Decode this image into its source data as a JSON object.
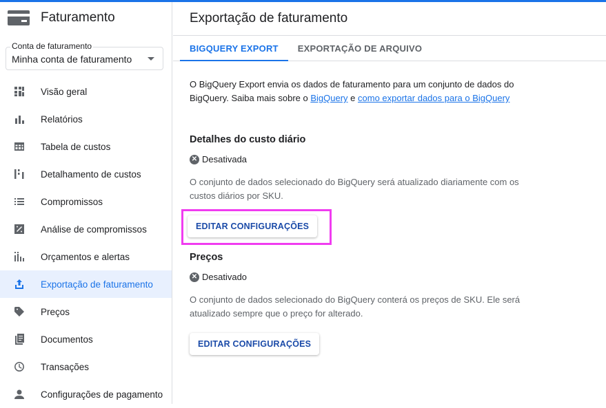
{
  "sidebar": {
    "title": "Faturamento",
    "account": {
      "label": "Conta de faturamento",
      "value": "Minha conta de faturamento"
    },
    "items": [
      {
        "label": "Visão geral",
        "icon": "dashboard-icon"
      },
      {
        "label": "Relatórios",
        "icon": "bar-chart-icon"
      },
      {
        "label": "Tabela de custos",
        "icon": "table-icon"
      },
      {
        "label": "Detalhamento de custos",
        "icon": "breakdown-icon"
      },
      {
        "label": "Compromissos",
        "icon": "list-icon"
      },
      {
        "label": "Análise de compromissos",
        "icon": "percent-icon"
      },
      {
        "label": "Orçamentos e alertas",
        "icon": "budget-icon"
      },
      {
        "label": "Exportação de faturamento",
        "icon": "upload-icon",
        "active": true
      },
      {
        "label": "Preços",
        "icon": "tag-icon"
      },
      {
        "label": "Documentos",
        "icon": "document-icon"
      },
      {
        "label": "Transações",
        "icon": "clock-icon"
      },
      {
        "label": "Configurações de pagamento",
        "icon": "person-icon"
      }
    ]
  },
  "main": {
    "title": "Exportação de faturamento",
    "tabs": [
      {
        "label": "BIGQUERY EXPORT",
        "active": true
      },
      {
        "label": "EXPORTAÇÃO DE ARQUIVO"
      }
    ],
    "intro": {
      "text_before": "O BigQuery Export envia os dados de faturamento para um conjunto de dados do BigQuery. Saiba mais sobre o ",
      "link1": "BigQuery",
      "text_middle": " e ",
      "link2": "como exportar dados para o BigQuery"
    },
    "sections": [
      {
        "title": "Detalhes do custo diário",
        "status": "Desativada",
        "description": "O conjunto de dados selecionado do BigQuery será atualizado diariamente com os custos diários por SKU.",
        "button": "EDITAR CONFIGURAÇÕES"
      },
      {
        "title": "Preços",
        "status": "Desativado",
        "description": "O conjunto de dados selecionado do BigQuery conterá os preços de SKU. Ele será atualizado sempre que o preço for alterado.",
        "button": "EDITAR CONFIGURAÇÕES"
      }
    ]
  },
  "colors": {
    "accent": "#1a73e8",
    "highlight": "#f03cf0"
  }
}
